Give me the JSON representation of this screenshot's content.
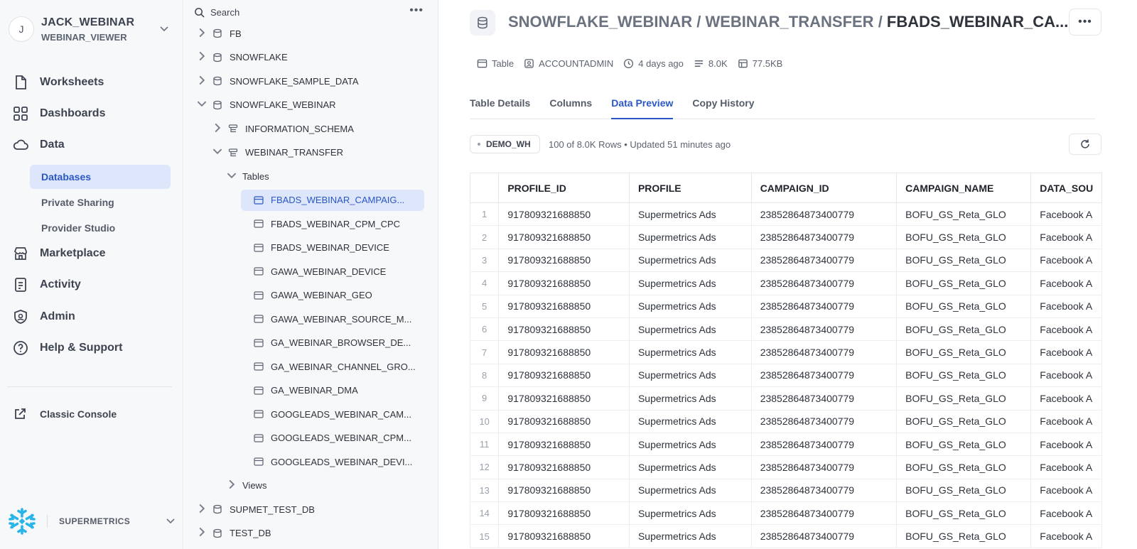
{
  "user": {
    "initial": "J",
    "name": "JACK_WEBINAR",
    "role": "WEBINAR_VIEWER"
  },
  "nav": {
    "worksheets": "Worksheets",
    "dashboards": "Dashboards",
    "data": "Data",
    "databases": "Databases",
    "private_sharing": "Private Sharing",
    "provider_studio": "Provider Studio",
    "marketplace": "Marketplace",
    "activity": "Activity",
    "admin": "Admin",
    "help": "Help & Support",
    "classic_console": "Classic Console",
    "account": "SUPERMETRICS"
  },
  "tree": {
    "search_placeholder": "Search",
    "more": "•••",
    "databases": [
      "FB",
      "SNOWFLAKE",
      "SNOWFLAKE_SAMPLE_DATA",
      "SNOWFLAKE_WEBINAR"
    ],
    "schemas": [
      "INFORMATION_SCHEMA",
      "WEBINAR_TRANSFER"
    ],
    "tables_label": "Tables",
    "tables": [
      "FBADS_WEBINAR_CAMPAIG...",
      "FBADS_WEBINAR_CPM_CPC",
      "FBADS_WEBINAR_DEVICE",
      "GAWA_WEBINAR_DEVICE",
      "GAWA_WEBINAR_GEO",
      "GAWA_WEBINAR_SOURCE_M...",
      "GA_WEBINAR_BROWSER_DE...",
      "GA_WEBINAR_CHANNEL_GRO...",
      "GA_WEBINAR_DMA",
      "GOOGLEADS_WEBINAR_CAM...",
      "GOOGLEADS_WEBINAR_CPM...",
      "GOOGLEADS_WEBINAR_DEVI..."
    ],
    "views_label": "Views",
    "bottom_databases": [
      "SUPMET_TEST_DB",
      "TEST_DB"
    ]
  },
  "header": {
    "crumb_db": "SNOWFLAKE_WEBINAR",
    "crumb_sep": " / ",
    "crumb_schema": "WEBINAR_TRANSFER",
    "crumb_table": "FBADS_WEBINAR_CA...",
    "more": "•••"
  },
  "meta": {
    "type": "Table",
    "owner": "ACCOUNTADMIN",
    "modified": "4 days ago",
    "rows": "8.0K",
    "size": "77.5KB"
  },
  "tabs": [
    "Table Details",
    "Columns",
    "Data Preview",
    "Copy History"
  ],
  "active_tab": "Data Preview",
  "preview": {
    "warehouse": "DEMO_WH",
    "info": "100 of 8.0K Rows • Updated 51 minutes ago",
    "columns": [
      "PROFILE_ID",
      "PROFILE",
      "CAMPAIGN_ID",
      "CAMPAIGN_NAME",
      "DATA_SOU"
    ],
    "rows": [
      [
        "1",
        "917809321688850",
        "Supermetrics Ads",
        "23852864873400779",
        "BOFU_GS_Reta_GLO",
        "Facebook A"
      ],
      [
        "2",
        "917809321688850",
        "Supermetrics Ads",
        "23852864873400779",
        "BOFU_GS_Reta_GLO",
        "Facebook A"
      ],
      [
        "3",
        "917809321688850",
        "Supermetrics Ads",
        "23852864873400779",
        "BOFU_GS_Reta_GLO",
        "Facebook A"
      ],
      [
        "4",
        "917809321688850",
        "Supermetrics Ads",
        "23852864873400779",
        "BOFU_GS_Reta_GLO",
        "Facebook A"
      ],
      [
        "5",
        "917809321688850",
        "Supermetrics Ads",
        "23852864873400779",
        "BOFU_GS_Reta_GLO",
        "Facebook A"
      ],
      [
        "6",
        "917809321688850",
        "Supermetrics Ads",
        "23852864873400779",
        "BOFU_GS_Reta_GLO",
        "Facebook A"
      ],
      [
        "7",
        "917809321688850",
        "Supermetrics Ads",
        "23852864873400779",
        "BOFU_GS_Reta_GLO",
        "Facebook A"
      ],
      [
        "8",
        "917809321688850",
        "Supermetrics Ads",
        "23852864873400779",
        "BOFU_GS_Reta_GLO",
        "Facebook A"
      ],
      [
        "9",
        "917809321688850",
        "Supermetrics Ads",
        "23852864873400779",
        "BOFU_GS_Reta_GLO",
        "Facebook A"
      ],
      [
        "10",
        "917809321688850",
        "Supermetrics Ads",
        "23852864873400779",
        "BOFU_GS_Reta_GLO",
        "Facebook A"
      ],
      [
        "11",
        "917809321688850",
        "Supermetrics Ads",
        "23852864873400779",
        "BOFU_GS_Reta_GLO",
        "Facebook A"
      ],
      [
        "12",
        "917809321688850",
        "Supermetrics Ads",
        "23852864873400779",
        "BOFU_GS_Reta_GLO",
        "Facebook A"
      ],
      [
        "13",
        "917809321688850",
        "Supermetrics Ads",
        "23852864873400779",
        "BOFU_GS_Reta_GLO",
        "Facebook A"
      ],
      [
        "14",
        "917809321688850",
        "Supermetrics Ads",
        "23852864873400779",
        "BOFU_GS_Reta_GLO",
        "Facebook A"
      ],
      [
        "15",
        "917809321688850",
        "Supermetrics Ads",
        "23852864873400779",
        "BOFU_GS_Reta_GLO",
        "Facebook A"
      ]
    ]
  },
  "colors": {
    "accent": "#2a56c6",
    "active_bg": "#dde6fb",
    "sidebar_bg": "#f7f8fa",
    "logo": "#29b5e8"
  }
}
